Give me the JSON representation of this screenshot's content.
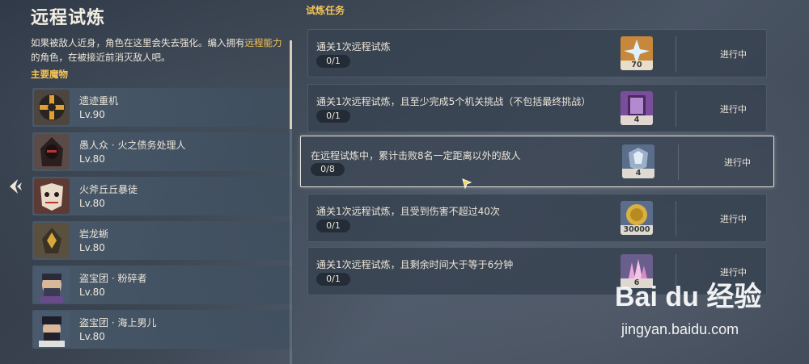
{
  "page_title": "远程试炼",
  "description": {
    "part1": "如果被敌人近身，角色在这里会失去强化。编入拥有",
    "highlight": "远程能力",
    "part2": "的角色，在被接近前消灭敌人吧。"
  },
  "monsters_label": "主要魔物",
  "monsters": [
    {
      "name": "遗迹重机",
      "level": "Lv.90",
      "icon": "ruin-grader-icon"
    },
    {
      "name": "愚人众 · 火之债务处理人",
      "level": "Lv.80",
      "icon": "fatui-pyro-agent-icon"
    },
    {
      "name": "火斧丘丘暴徒",
      "level": "Lv.80",
      "icon": "pyro-hilichurl-brute-icon"
    },
    {
      "name": "岩龙蜥",
      "level": "Lv.80",
      "icon": "geovishap-icon"
    },
    {
      "name": "盗宝团 · 粉碎者",
      "level": "Lv.80",
      "icon": "treasure-hoarder-crusher-icon"
    },
    {
      "name": "盗宝团 · 海上男儿",
      "level": "Lv.80",
      "icon": "treasure-hoarder-seaman-icon"
    }
  ],
  "tasks_label": "试炼任务",
  "tasks": [
    {
      "text": "通关1次远程试炼",
      "progress": "0/1",
      "reward_count": "70",
      "reward_icon": "primogem-icon",
      "status": "进行中"
    },
    {
      "text": "通关1次远程试炼，且至少完成5个机关挑战（不包括最终挑战）",
      "progress": "0/1",
      "reward_count": "4",
      "reward_icon": "heros-wit-icon",
      "status": "进行中"
    },
    {
      "text": "在远程试炼中，累计击败8名一定距离以外的敌人",
      "progress": "0/8",
      "reward_count": "4",
      "reward_icon": "mystic-enhancement-ore-icon",
      "status": "进行中"
    },
    {
      "text": "通关1次远程试炼，且受到伤害不超过40次",
      "progress": "0/1",
      "reward_count": "30000",
      "reward_icon": "mora-icon",
      "status": "进行中"
    },
    {
      "text": "通关1次远程试炼，且剩余时间大于等于6分钟",
      "progress": "0/1",
      "reward_count": "6",
      "reward_icon": "crystal-chunk-icon",
      "status": "进行中"
    }
  ],
  "watermark": {
    "logo": "Bai du 经验",
    "url": "jingyan.baidu.com"
  }
}
